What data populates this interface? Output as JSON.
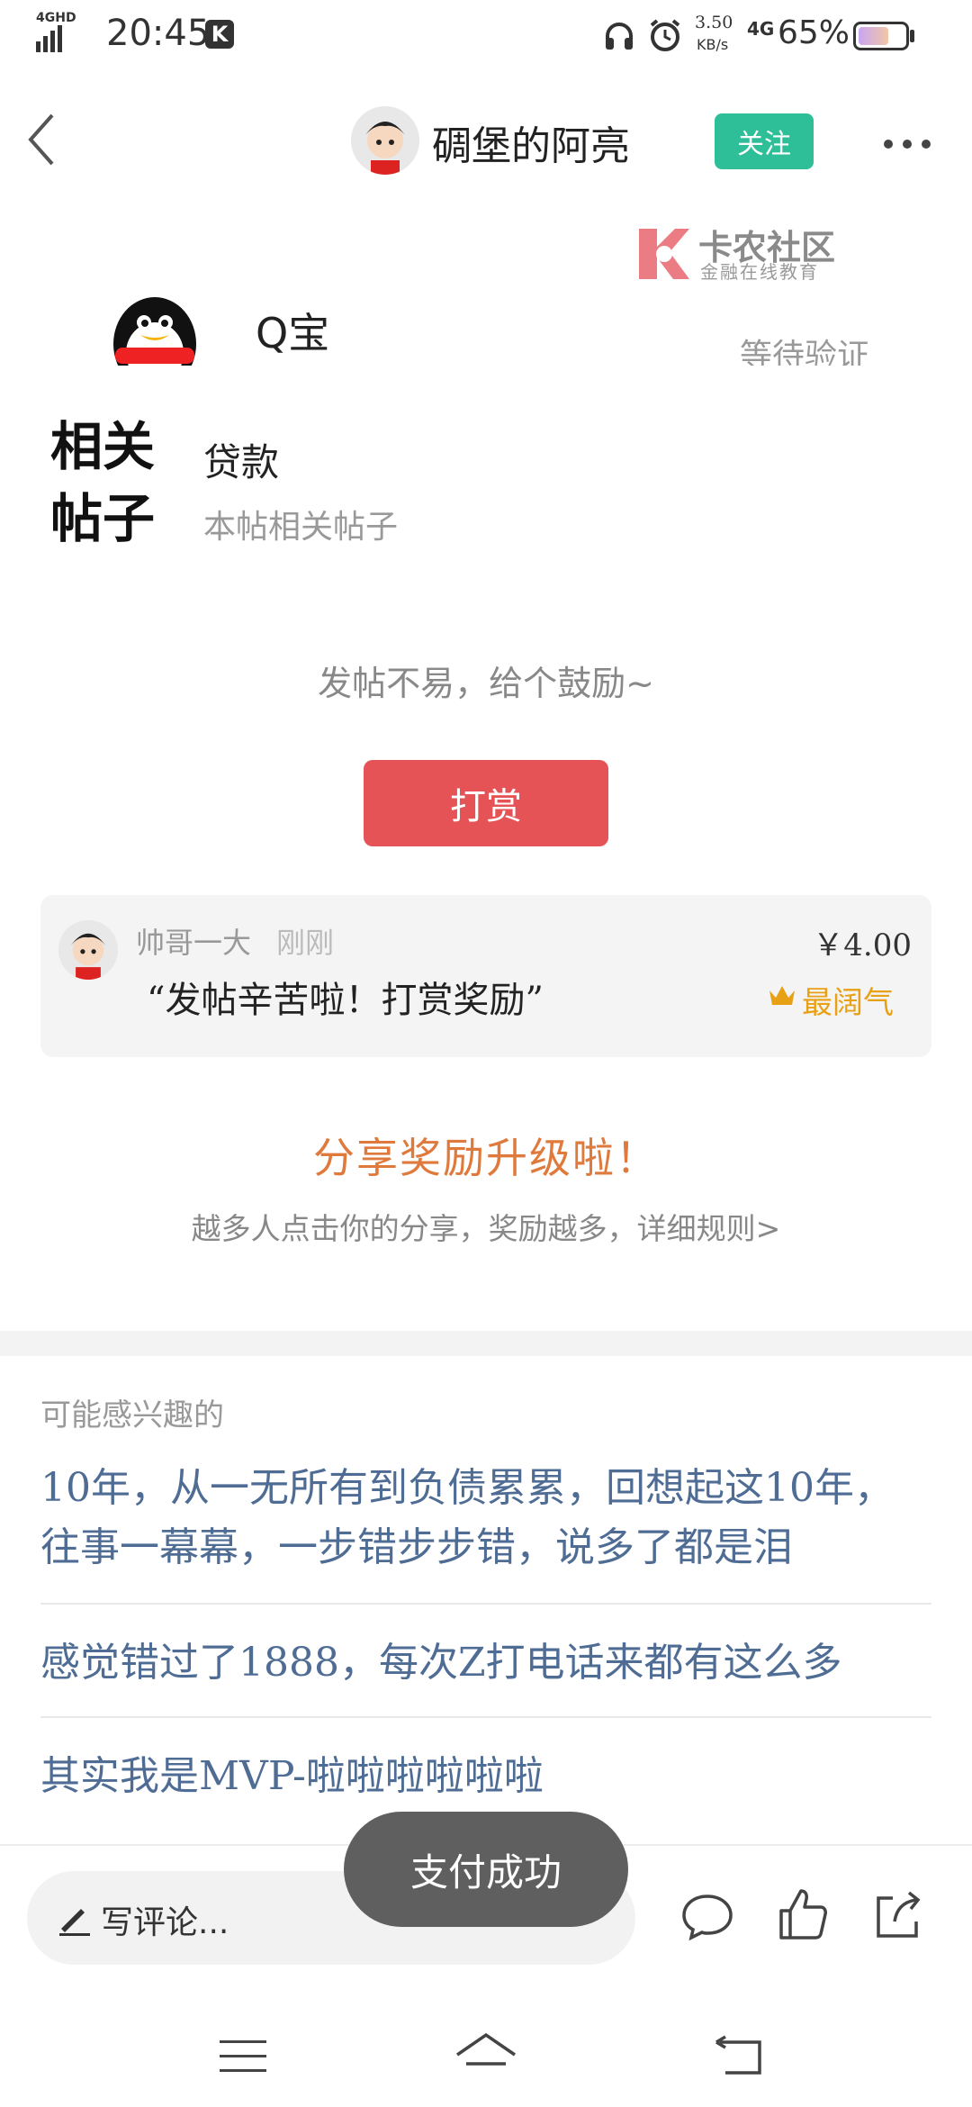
{
  "status_bar": {
    "network": "4GHD",
    "time": "20:45",
    "app_badge": "K",
    "speed_value": "3.50",
    "speed_unit": "KB/s",
    "network2": "4G",
    "battery": "65%",
    "battery_level": 0.65
  },
  "header": {
    "username": "碉堡的阿亮",
    "follow_label": "关注"
  },
  "post_image": {
    "brand_name": "卡农社区",
    "brand_sub": "金融在线教育",
    "qq_name": "Q宝",
    "status_text": "等待验证"
  },
  "related": {
    "title_line1": "相关",
    "title_line2": "帖子",
    "tag": "贷款",
    "subtitle": "本帖相关帖子"
  },
  "tip": {
    "encourage_text": "发帖不易，给个鼓励~",
    "button_label": "打赏",
    "record": {
      "user": "帅哥一大",
      "time": "刚刚",
      "message": "“发帖辛苦啦！打赏奖励”",
      "amount": "￥4.00",
      "badge": "最阔气"
    }
  },
  "share": {
    "title": "分享奖励升级啦！",
    "description": "越多人点击你的分享，奖励越多，详细规则>"
  },
  "recommend": {
    "header": "可能感兴趣的",
    "items": [
      {
        "line1": "10年，从一无所有到负债累累，回想起这10年，",
        "line2": "往事一幕幕，一步错步步错，说多了都是泪"
      },
      {
        "line1": "感觉错过了1888，每次Z打电话来都有这么多",
        "line2": ""
      },
      {
        "line1": "其实我是MVP-啦啦啦啦啦啦",
        "line2": ""
      }
    ]
  },
  "bottom_bar": {
    "comment_placeholder": "写评论...",
    "toast": "支付成功"
  },
  "colors": {
    "accent_green": "#2fbf98",
    "tip_red": "#e65356",
    "share_orange": "#e07a3c",
    "link_blue": "#4f6d94",
    "badge_gold": "#e8a015"
  }
}
